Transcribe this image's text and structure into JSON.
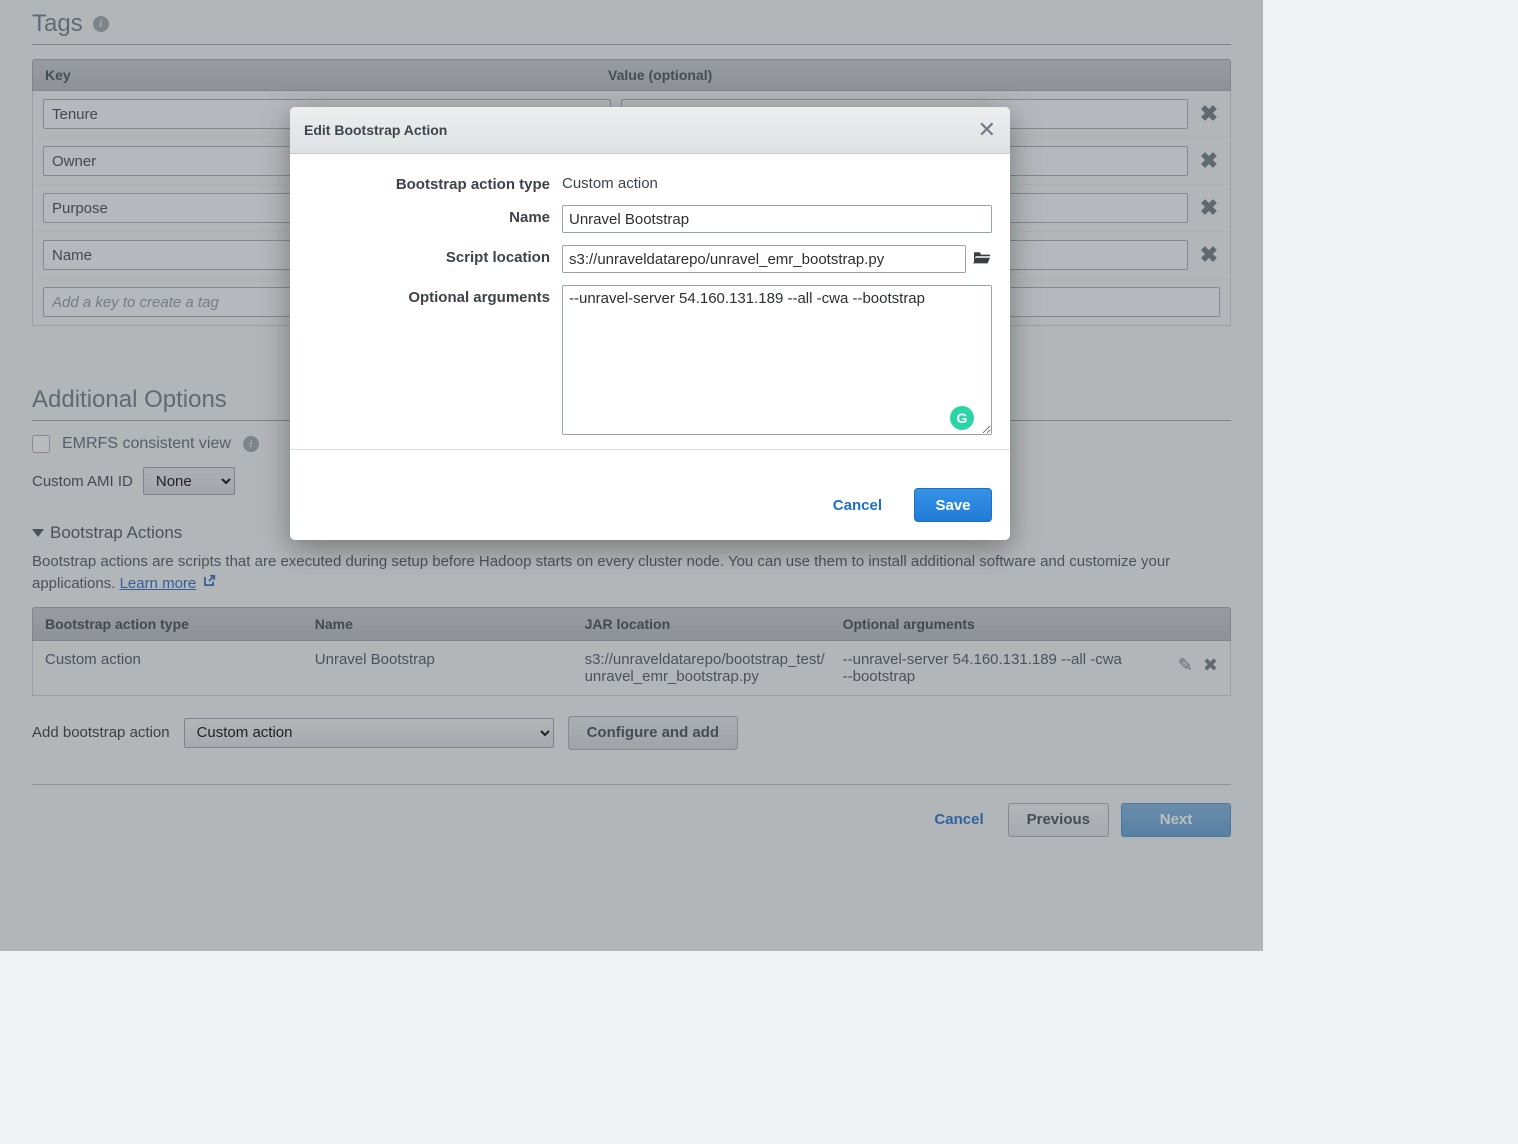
{
  "tags": {
    "title": "Tags",
    "header": {
      "key": "Key",
      "value": "Value (optional)"
    },
    "rows": [
      {
        "key": "Tenure",
        "value": ""
      },
      {
        "key": "Owner",
        "value": ""
      },
      {
        "key": "Purpose",
        "value": ""
      },
      {
        "key": "Name",
        "value": ""
      }
    ],
    "add_placeholder": "Add a key to create a tag"
  },
  "additional": {
    "title": "Additional Options",
    "emrfs_label": "EMRFS consistent view",
    "ami_label": "Custom AMI ID",
    "ami_value": "None"
  },
  "bootstrap": {
    "section_title": "Bootstrap Actions",
    "description": "Bootstrap actions are scripts that are executed during setup before Hadoop starts on every cluster node. You can use them to install additional software and customize your applications. ",
    "learn_more": "Learn more",
    "header": {
      "type": "Bootstrap action type",
      "name": "Name",
      "jar": "JAR location",
      "args": "Optional arguments"
    },
    "rows": [
      {
        "type": "Custom action",
        "name": "Unravel Bootstrap",
        "jar": "s3://unraveldatarepo/bootstrap_test/unravel_emr_bootstrap.py",
        "args": "--unravel-server 54.160.131.189 --all -cwa --bootstrap"
      }
    ],
    "add_label": "Add bootstrap action",
    "add_value": "Custom action",
    "configure_label": "Configure and add"
  },
  "footer": {
    "cancel": "Cancel",
    "previous": "Previous",
    "next": "Next"
  },
  "modal": {
    "title": "Edit Bootstrap Action",
    "labels": {
      "type": "Bootstrap action type",
      "name": "Name",
      "script": "Script location",
      "args": "Optional arguments"
    },
    "values": {
      "type": "Custom action",
      "name": "Unravel Bootstrap",
      "script": "s3://unraveldatarepo/unravel_emr_bootstrap.py",
      "args": "--unravel-server 54.160.131.189 --all -cwa --bootstrap"
    },
    "cancel": "Cancel",
    "save": "Save"
  }
}
